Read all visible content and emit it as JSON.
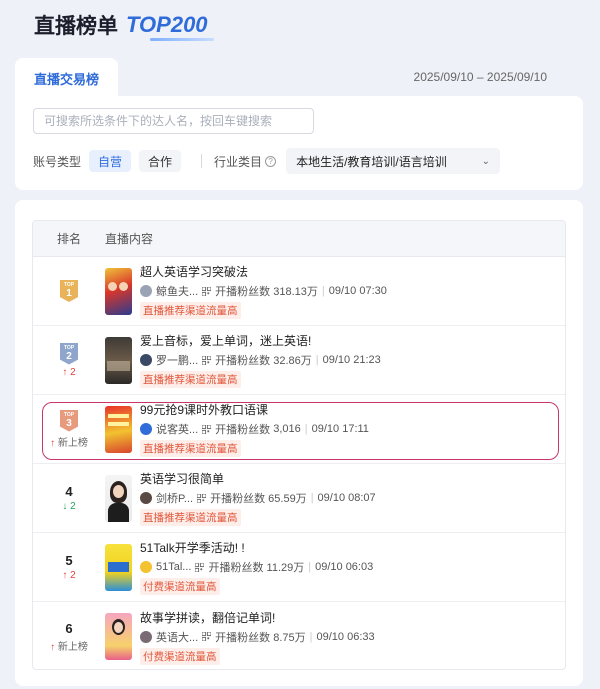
{
  "page": {
    "title": "直播榜单",
    "title_badge": "TOP200"
  },
  "tabs": [
    {
      "label": "直播交易榜",
      "active": true
    }
  ],
  "date_range": "2025/09/10 – 2025/09/10",
  "search": {
    "placeholder": "可搜索所选条件下的达人名，按回车键搜索",
    "value": ""
  },
  "filters": {
    "account_type_label": "账号类型",
    "account_options": [
      "自营",
      "合作"
    ],
    "account_selected": "自营",
    "industry_label": "行业类目",
    "industry_value": "本地生活/教育培训/语言培训"
  },
  "table": {
    "columns": [
      "排名",
      "直播内容"
    ],
    "fans_label": "开播粉丝数",
    "rows": [
      {
        "rank": "1",
        "badge": "TOP",
        "change": "",
        "title": "超人英语学习突破法",
        "author": "鲸鱼夫...",
        "fans": "318.13万",
        "time": "09/10 07:30",
        "tag": "直播推荐渠道流量高"
      },
      {
        "rank": "2",
        "badge": "TOP",
        "change": "↑ 2",
        "change_type": "up",
        "title": "爱上音标，爱上单词，迷上英语!",
        "author": "罗一鹏...",
        "fans": "32.86万",
        "time": "09/10 21:23",
        "tag": "直播推荐渠道流量高"
      },
      {
        "rank": "3",
        "badge": "TOP",
        "change": "新上榜",
        "change_type": "new",
        "title": "99元抢9课时外教口语课",
        "author": "说客英...",
        "fans": "3,016",
        "time": "09/10 17:11",
        "tag": "直播推荐渠道流量高"
      },
      {
        "rank": "4",
        "change": "↓ 2",
        "change_type": "down",
        "title": "英语学习很简单",
        "author": "剑桥P...",
        "fans": "65.59万",
        "time": "09/10 08:07",
        "tag": "直播推荐渠道流量高"
      },
      {
        "rank": "5",
        "change": "↑ 2",
        "change_type": "up",
        "title": "51Talk开学季活动! !",
        "author": "51Tal...",
        "fans": "11.29万",
        "time": "09/10 06:03",
        "tag": "付费渠道流量高"
      },
      {
        "rank": "6",
        "change": "新上榜",
        "change_type": "new",
        "title": "故事学拼读，翻倍记单词!",
        "author": "英语大...",
        "fans": "8.75万",
        "time": "09/10 06:33",
        "tag": "付费渠道流量高"
      }
    ]
  },
  "colors": {
    "accent": "#2f6bd9",
    "tag_text": "#e2573b",
    "up": "#e0443a",
    "down": "#24a15a",
    "highlight": "#c9356a"
  }
}
